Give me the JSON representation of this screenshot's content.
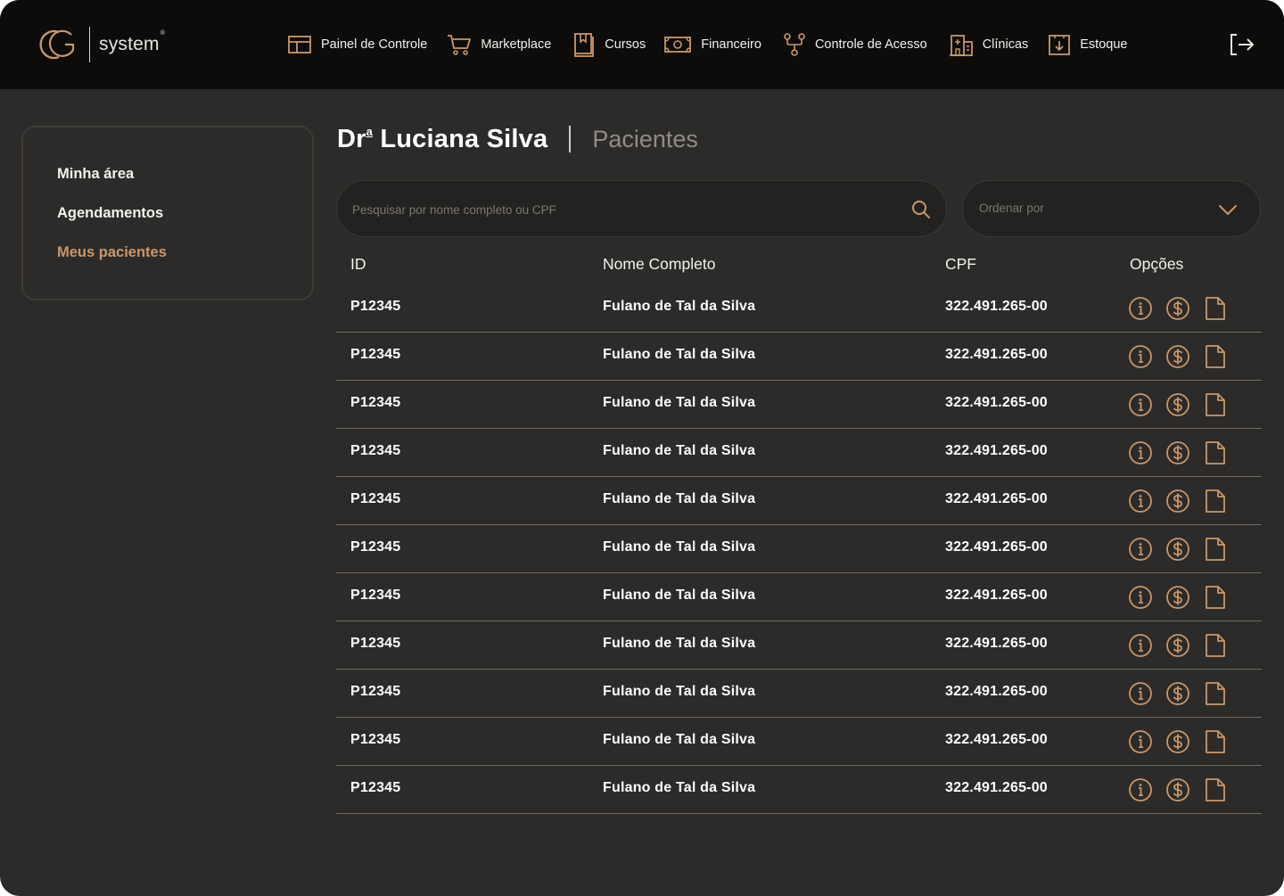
{
  "brand": {
    "name": "system",
    "mark": "®"
  },
  "nav": [
    {
      "label": "Painel de Controle",
      "icon": "dashboard-icon"
    },
    {
      "label": "Marketplace",
      "icon": "cart-icon"
    },
    {
      "label": "Cursos",
      "icon": "book-icon"
    },
    {
      "label": "Financeiro",
      "icon": "money-icon"
    },
    {
      "label": "Controle de Acesso",
      "icon": "access-icon"
    },
    {
      "label": "Clínicas",
      "icon": "building-icon"
    },
    {
      "label": "Estoque",
      "icon": "download-box-icon"
    }
  ],
  "sidebar": {
    "items": [
      {
        "label": "Minha área",
        "active": false
      },
      {
        "label": "Agendamentos",
        "active": false
      },
      {
        "label": "Meus pacientes",
        "active": true
      }
    ]
  },
  "header": {
    "name_prefix": "Dr",
    "name_suffix": "a",
    "name": "Luciana Silva",
    "section": "Pacientes"
  },
  "search": {
    "placeholder": "Pesquisar por nome completo ou CPF",
    "value": ""
  },
  "sort": {
    "placeholder": "Ordenar por"
  },
  "table": {
    "columns": [
      "ID",
      "Nome Completo",
      "CPF",
      "Opções"
    ],
    "rows": [
      {
        "id": "P12345",
        "name": "Fulano de Tal da Silva",
        "cpf": "322.491.265-00"
      },
      {
        "id": "P12345",
        "name": "Fulano de Tal da Silva",
        "cpf": "322.491.265-00"
      },
      {
        "id": "P12345",
        "name": "Fulano de Tal da Silva",
        "cpf": "322.491.265-00"
      },
      {
        "id": "P12345",
        "name": "Fulano de Tal da Silva",
        "cpf": "322.491.265-00"
      },
      {
        "id": "P12345",
        "name": "Fulano de Tal da Silva",
        "cpf": "322.491.265-00"
      },
      {
        "id": "P12345",
        "name": "Fulano de Tal da Silva",
        "cpf": "322.491.265-00"
      },
      {
        "id": "P12345",
        "name": "Fulano de Tal da Silva",
        "cpf": "322.491.265-00"
      },
      {
        "id": "P12345",
        "name": "Fulano de Tal da Silva",
        "cpf": "322.491.265-00"
      },
      {
        "id": "P12345",
        "name": "Fulano de Tal da Silva",
        "cpf": "322.491.265-00"
      },
      {
        "id": "P12345",
        "name": "Fulano de Tal da Silva",
        "cpf": "322.491.265-00"
      },
      {
        "id": "P12345",
        "name": "Fulano de Tal da Silva",
        "cpf": "322.491.265-00"
      }
    ],
    "row_options": [
      "info-icon",
      "dollar-coin-icon",
      "document-icon"
    ]
  },
  "colors": {
    "accent": "#c9976c",
    "background": "#2c2b29",
    "topbar": "#0d0c0b",
    "text": "#ffffff",
    "muted": "#8f8c88"
  }
}
